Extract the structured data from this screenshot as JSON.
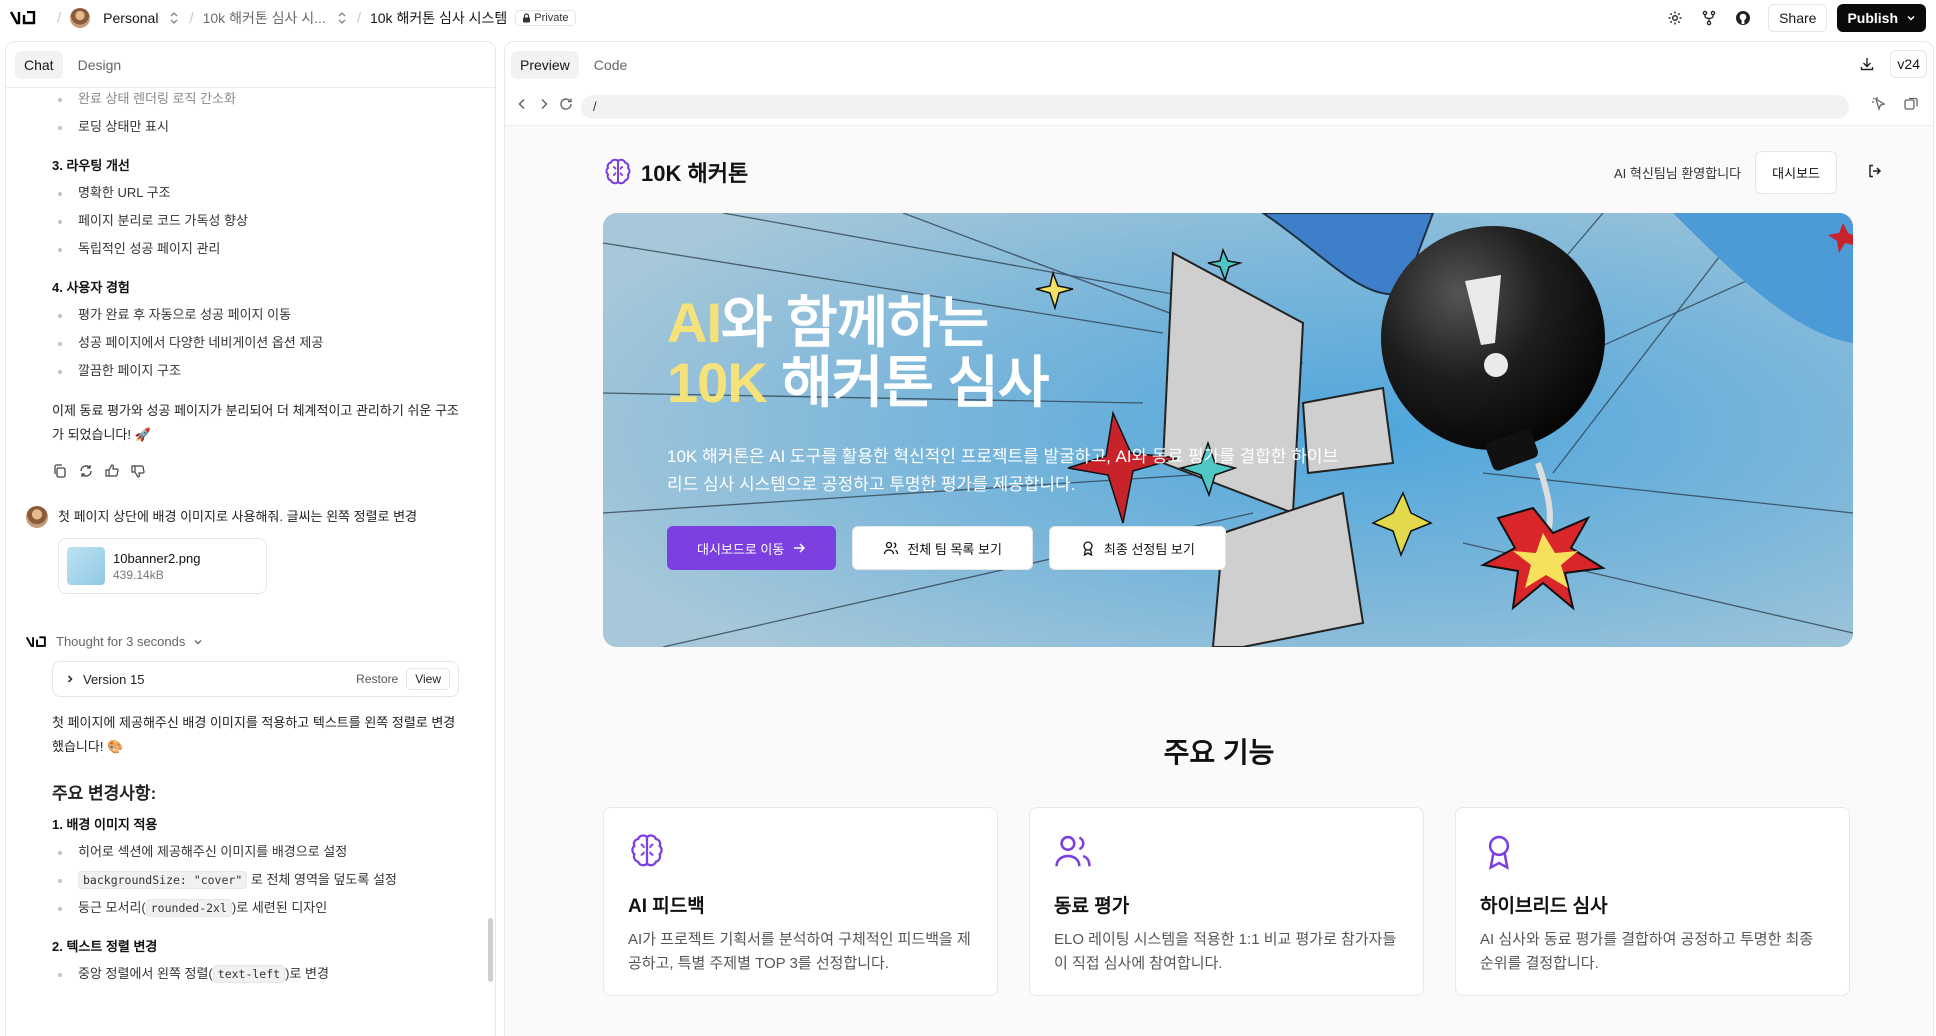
{
  "topbar": {
    "workspace": "Personal",
    "project": "10k 해커톤 심사 시...",
    "chat_title": "10k 해커톤 심사 시스템",
    "visibility": "Private",
    "share_label": "Share",
    "publish_label": "Publish"
  },
  "left_tabs": {
    "chat": "Chat",
    "design": "Design"
  },
  "chat": {
    "top_bullets": [
      "완료 상태 렌더링 로직 간소화",
      "로딩 상태만 표시"
    ],
    "routing_heading": "3. 라우팅 개선",
    "routing_bullets": [
      "명확한 URL 구조",
      "페이지 분리로 코드 가독성 향상",
      "독립적인 성공 페이지 관리"
    ],
    "ux_heading": "4. 사용자 경험",
    "ux_bullets": [
      "평가 완료 후 자동으로 성공 페이지 이동",
      "성공 페이지에서 다양한 네비게이션 옵션 제공",
      "깔끔한 페이지 구조"
    ],
    "summary": "이제 동료 평가와 성공 페이지가 분리되어 더 체계적이고 관리하기 쉬운 구조가 되었습니다! 🚀",
    "user_message": "첫 페이지 상단에 배경 이미지로 사용해줘. 글씨는 왼쪽 정렬로 변경",
    "attachment_name": "10banner2.png",
    "attachment_size": "439.14kB",
    "thought": "Thought for 3 seconds",
    "version_label": "Version 15",
    "restore_label": "Restore",
    "view_label": "View",
    "reply": "첫 페이지에 제공해주신 배경 이미지를 적용하고 텍스트를 왼쪽 정렬로 변경했습니다! 🎨",
    "changes_heading": "주요 변경사항:",
    "bg_heading": "1. 배경 이미지 적용",
    "bg_b1": "히어로 섹션에 제공해주신 이미지를 배경으로 설정",
    "bg_b2_code": "backgroundSize: \"cover\"",
    "bg_b2_text": "로 전체 영역을 덮도록 설정",
    "bg_b3_pre": "둥근 모서리(",
    "bg_b3_code": "rounded-2xl",
    "bg_b3_post": ")로 세련된 디자인",
    "align_heading": "2. 텍스트 정렬 변경",
    "align_b1_pre": "중앙 정렬에서 왼쪽 정렬(",
    "align_b1_code": "text-left",
    "align_b1_post": ")로 변경"
  },
  "right_tabs": {
    "preview": "Preview",
    "code": "Code",
    "version": "v24"
  },
  "url": "/",
  "site": {
    "brand": "10K 해커톤",
    "welcome": "AI 혁신팀님 환영합니다",
    "dashboard": "대시보드",
    "hero_title_hl1": "AI",
    "hero_title_rest1": "와 함께하는",
    "hero_title_hl2": "10K",
    "hero_title_rest2": " 해커톤 심사",
    "hero_desc": "10K 해커톤은 AI 도구를 활용한 혁신적인 프로젝트를 발굴하고, AI와 동료 평가를 결합한 하이브리드 심사 시스템으로 공정하고 투명한 평가를 제공합니다.",
    "btn_dashboard": "대시보드로 이동",
    "btn_teams": "전체 팀 목록 보기",
    "btn_final": "최종 선정팀 보기",
    "features_title": "주요 기능",
    "features": [
      {
        "title": "AI 피드백",
        "desc": "AI가 프로젝트 기획서를 분석하여 구체적인 피드백을 제공하고, 특별 주제별 TOP 3를 선정합니다."
      },
      {
        "title": "동료 평가",
        "desc": "ELO 레이팅 시스템을 적용한 1:1 비교 평가로 참가자들이 직접 심사에 참여합니다."
      },
      {
        "title": "하이브리드 심사",
        "desc": "AI 심사와 동료 평가를 결합하여 공정하고 투명한 최종 순위를 결정합니다."
      }
    ]
  },
  "colors": {
    "accent": "#7c3fe0",
    "hero_bg": "#9fc3d6",
    "highlight": "#f5e27a"
  }
}
